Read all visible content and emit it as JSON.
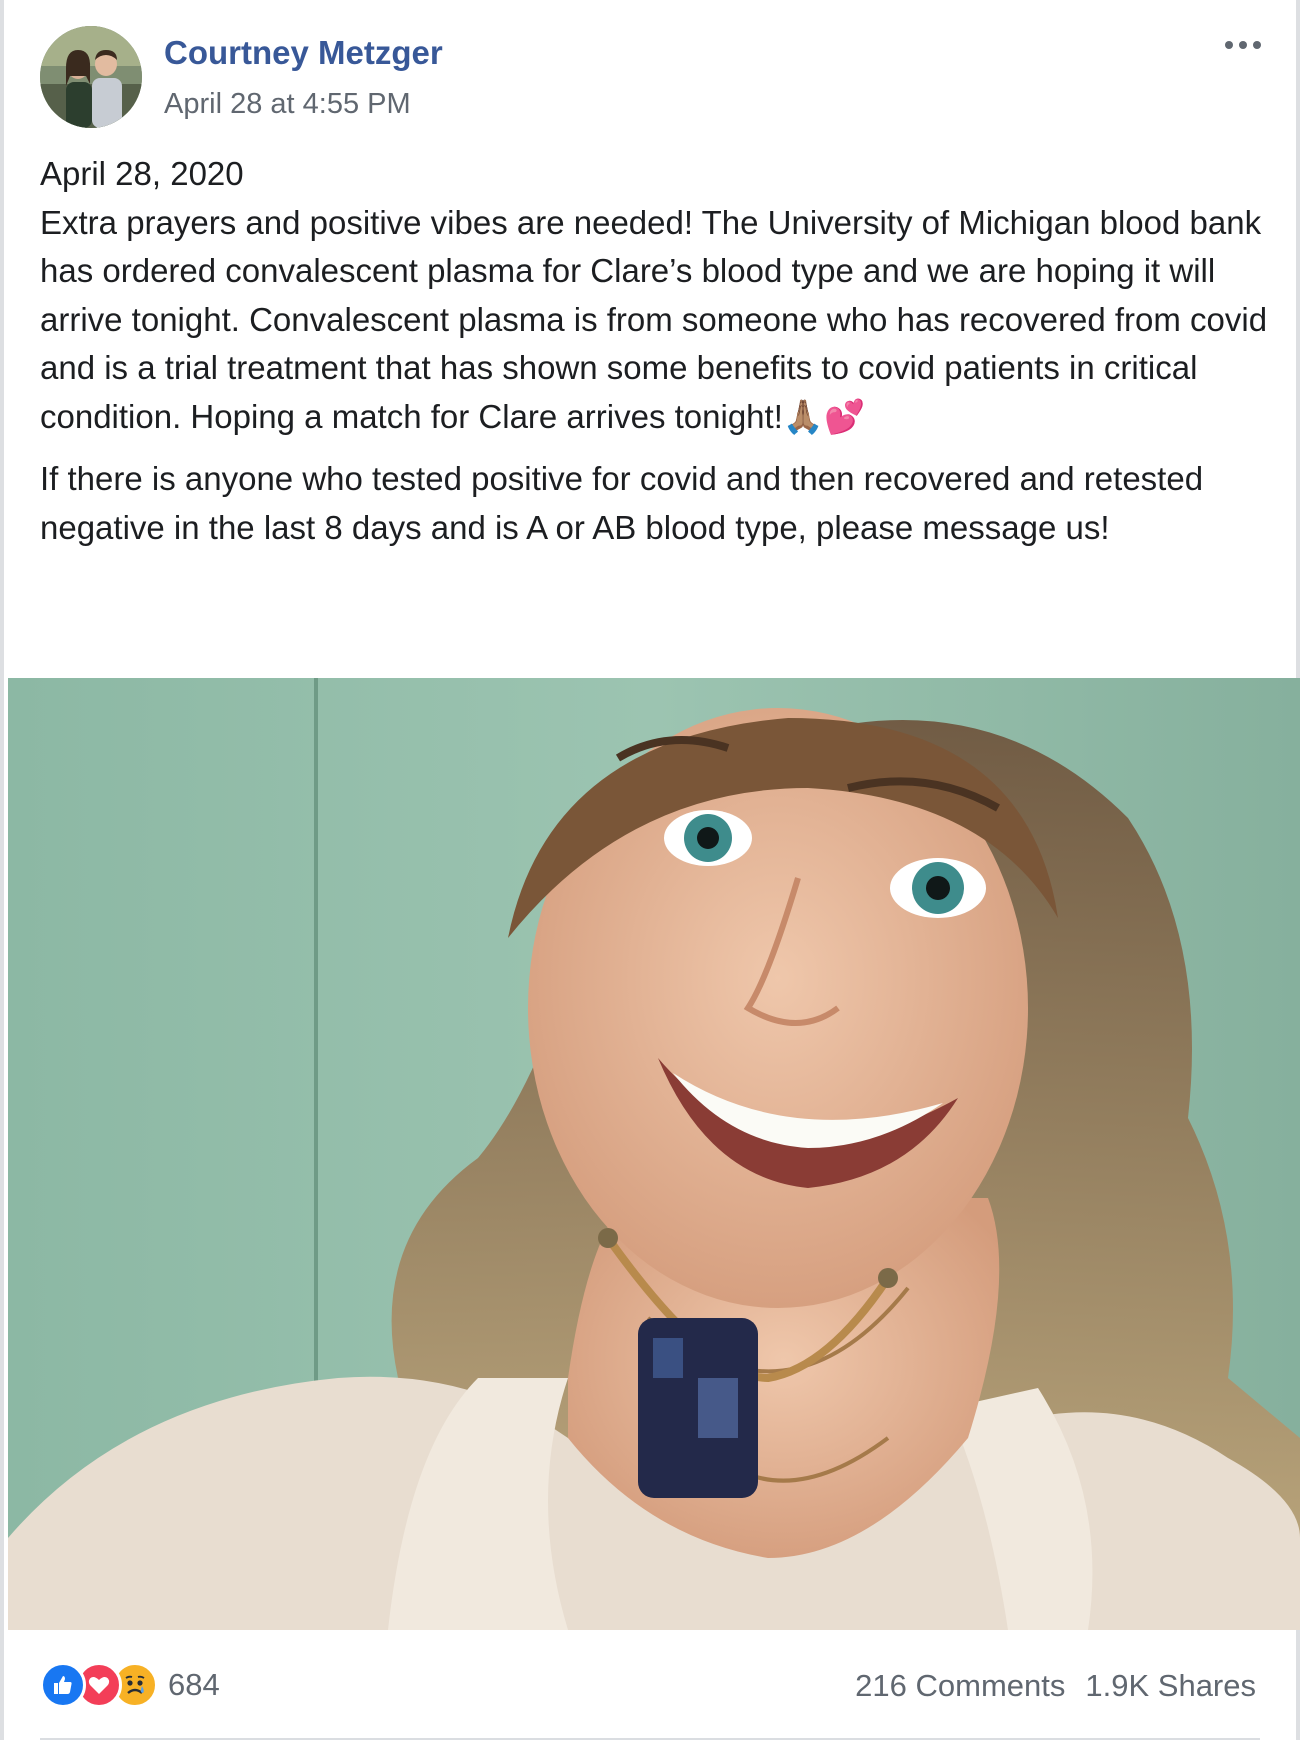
{
  "post": {
    "author": "Courtney Metzger",
    "timestamp": "April 28 at 4:55 PM",
    "more_icon": "ellipsis-icon",
    "paragraphs": [
      "April 28, 2020\nExtra prayers and positive vibes are needed! The University of Michigan blood bank has ordered convalescent plasma for Clare’s blood type and we are hoping it will arrive tonight. Convalescent plasma is from someone who has recovered from covid and is a trial treatment that has shown some benefits to covid patients in critical condition. Hoping a match for Clare arrives tonight!🙏🏽💕",
      "If there is anyone who tested positive for covid and then recovered and retested negative in the last 8 days and is A or AB blood type, please message us!"
    ]
  },
  "reactions": {
    "icons": [
      "like-icon",
      "love-icon",
      "sad-icon"
    ],
    "count": "684"
  },
  "engagement": {
    "comments": "216 Comments",
    "shares": "1.9K Shares"
  },
  "colors": {
    "author_link": "#385898",
    "meta_text": "#606770",
    "body_text": "#1c1e21",
    "like": "#1877f2",
    "love": "#f33e58",
    "sad": "#f7b125"
  }
}
